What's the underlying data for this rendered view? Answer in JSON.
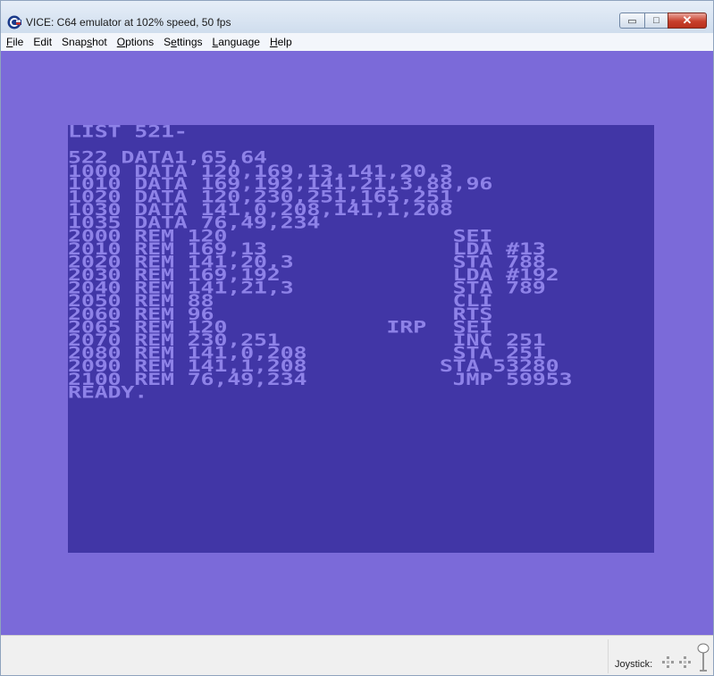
{
  "window": {
    "title": "VICE: C64 emulator at 102% speed, 50 fps",
    "minimize_glyph": "▭",
    "maximize_glyph": "□",
    "close_glyph": "✕"
  },
  "menu": {
    "items": [
      {
        "pre": "",
        "u": "F",
        "post": "ile"
      },
      {
        "pre": "Edit",
        "u": "",
        "post": ""
      },
      {
        "pre": "Snap",
        "u": "s",
        "post": "hot"
      },
      {
        "pre": "",
        "u": "O",
        "post": "ptions"
      },
      {
        "pre": "S",
        "u": "e",
        "post": "ttings"
      },
      {
        "pre": "",
        "u": "L",
        "post": "anguage"
      },
      {
        "pre": "",
        "u": "H",
        "post": "elp"
      }
    ]
  },
  "screen": {
    "lines": [
      "LIST 521-",
      "",
      "522 DATA1,65,64",
      "1000 DATA 120,169,13,141,20,3",
      "1010 DATA 169,192,141,21,3,88,96",
      "1020 DATA 120,230,251,165,251",
      "1030 DATA 141,0,208,141,1,208",
      "1035 DATA 76,49,234",
      "2000 REM 120                 SEI",
      "2010 REM 169,13              LDA #13",
      "2020 REM 141,20,3            STA 788",
      "2030 REM 169,192             LDA #192",
      "2040 REM 141,21,3            STA 789",
      "2050 REM 88                  CLI",
      "2060 REM 96                  RTS",
      "2065 REM 120            IRP  SEI",
      "2070 REM 230,251             INC 251",
      "2080 REM 141,0,208           STA 251",
      "2090 REM 141,1,208          STA 53280",
      "2100 REM 76,49,234           JMP 59953",
      "READY."
    ],
    "colors": {
      "border": "#7b6ad9",
      "background": "#4136a6",
      "text": "#8e82e8"
    }
  },
  "status": {
    "joystick_label": "Joystick:",
    "icons": [
      "joystick-port1-icon",
      "joystick-port2-icon",
      "joystick-handle-icon"
    ]
  }
}
